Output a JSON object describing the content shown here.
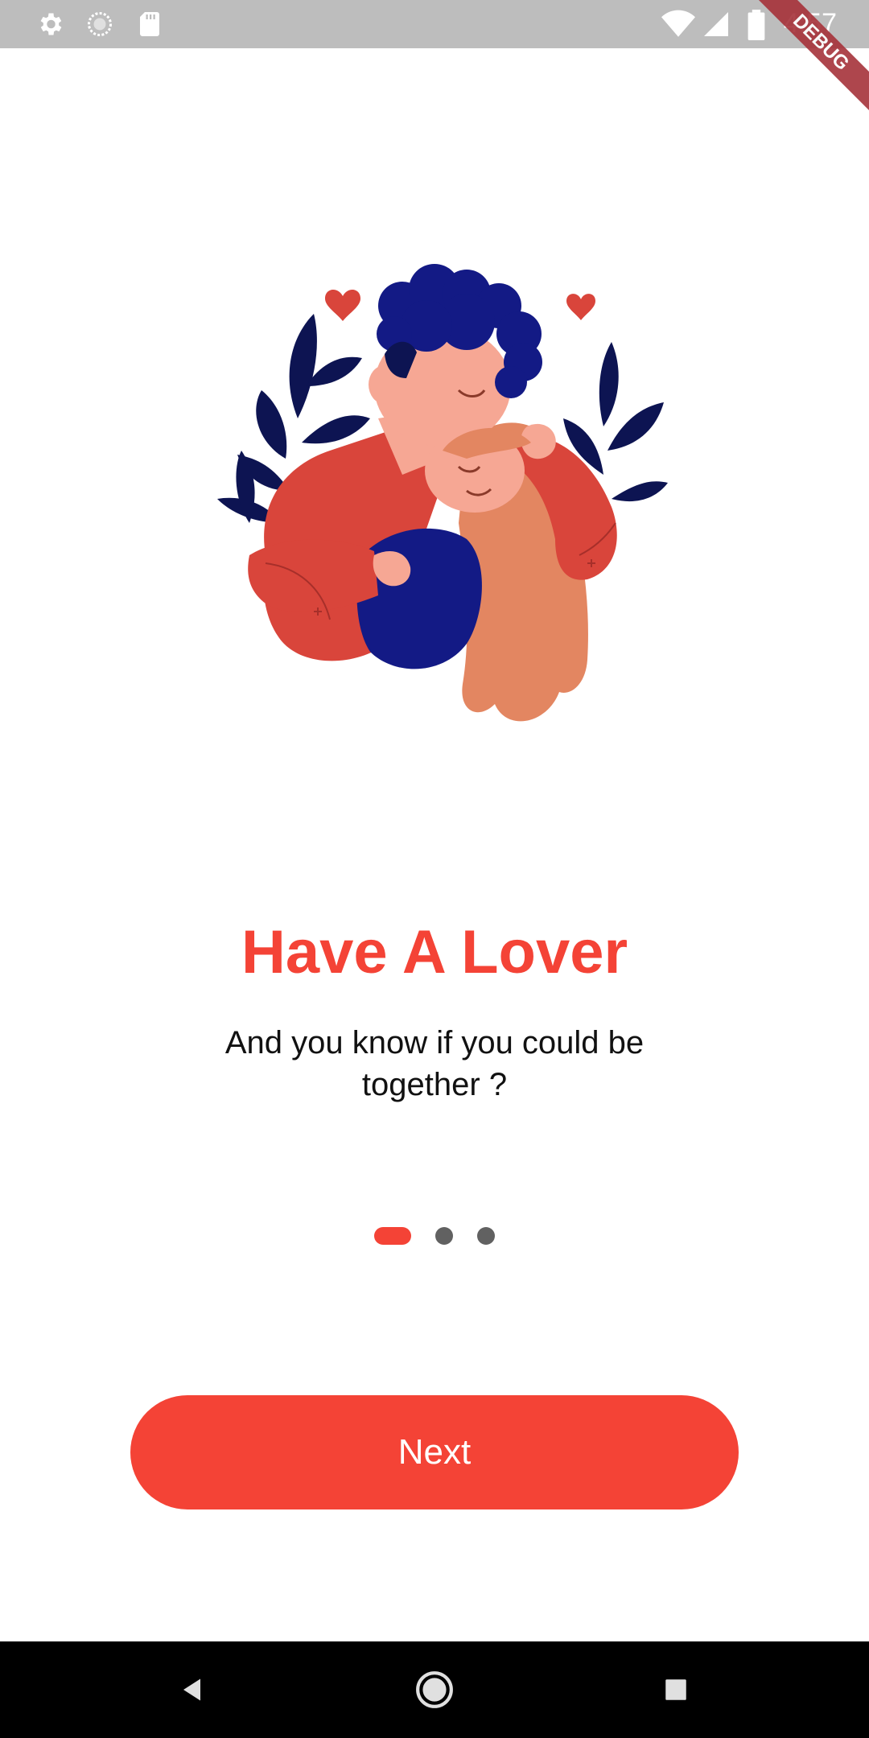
{
  "status_bar": {
    "time": "4:57",
    "icons": [
      "settings-icon",
      "sync-icon",
      "sd-card-icon",
      "wifi-icon",
      "signal-icon",
      "battery-icon"
    ]
  },
  "debug_banner": "DEBUG",
  "onboarding": {
    "title": "Have A Lover",
    "subtitle": "And you know if you could be together ?",
    "page_indicator": {
      "count": 3,
      "active_index": 0
    },
    "next_label": "Next"
  },
  "colors": {
    "accent": "#f44336",
    "dot_inactive": "#616161",
    "status_bar": "#bdbdbd"
  },
  "nav_bar": {
    "buttons": [
      "back-icon",
      "home-icon",
      "recents-icon"
    ]
  }
}
